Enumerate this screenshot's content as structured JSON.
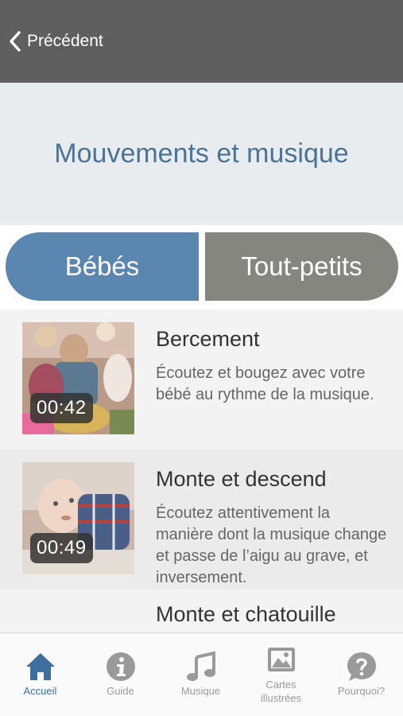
{
  "header": {
    "back_label": "Précédent"
  },
  "page": {
    "title": "Mouvements et musique"
  },
  "segments": {
    "left": "Bébés",
    "right": "Tout-petits",
    "selected": "Bébés"
  },
  "items": [
    {
      "title": "Bercement",
      "description": "Écoutez et bougez avec votre bébé au rythme de la musique.",
      "duration": "00:42"
    },
    {
      "title": "Monte et descend",
      "description": "Écoutez attentivement la manière dont la musique change et passe de l’aigu au grave, et inversement.",
      "duration": "00:49"
    },
    {
      "title": "Monte et chatouille",
      "description": "",
      "duration": ""
    }
  ],
  "tabs": [
    {
      "label": "Accueil",
      "icon": "home-icon",
      "active": true
    },
    {
      "label": "Guide",
      "icon": "info-icon",
      "active": false
    },
    {
      "label": "Musique",
      "icon": "music-note-icon",
      "active": false
    },
    {
      "label": "Cartes illustrées",
      "icon": "picture-icon",
      "active": false
    },
    {
      "label": "Pourquoi?",
      "icon": "question-bubble-icon",
      "active": false
    }
  ],
  "colors": {
    "header_bar": "#5f5f5f",
    "title_text": "#4a7394",
    "segment_selected": "#5a86b0",
    "segment_unselected": "#868680",
    "tab_active": "#3e6f9e",
    "tab_inactive": "#9a9a9a"
  }
}
